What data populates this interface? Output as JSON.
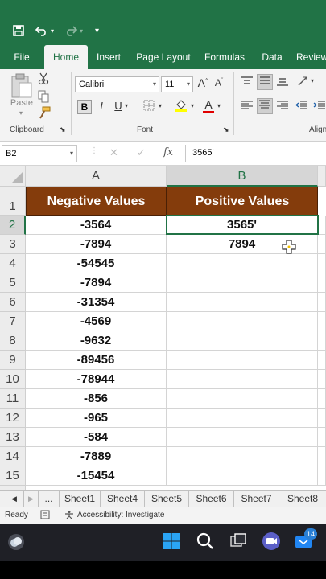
{
  "titlebar": {
    "undo_icon": "undo-icon",
    "redo_icon": "redo-icon"
  },
  "tabs": [
    {
      "label": "File"
    },
    {
      "label": "Home"
    },
    {
      "label": "Insert"
    },
    {
      "label": "Page Layout"
    },
    {
      "label": "Formulas"
    },
    {
      "label": "Data"
    },
    {
      "label": "Review"
    }
  ],
  "ribbon": {
    "paste_label": "Paste",
    "clipboard_label": "Clipboard",
    "font_label": "Font",
    "align_label": "Alignm",
    "font_name": "Calibri",
    "font_size": "11",
    "grow_font": "A",
    "shrink_font": "A",
    "bold": "B",
    "italic": "I",
    "underline": "U",
    "font_color": "A"
  },
  "formula_bar": {
    "name_box": "B2",
    "fx": "fx",
    "content": "3565'",
    "cancel": "✕",
    "confirm": "✓"
  },
  "columns": [
    {
      "label": "A"
    },
    {
      "label": "B"
    }
  ],
  "rows": [
    "1",
    "2",
    "3",
    "4",
    "5",
    "6",
    "7",
    "8",
    "9",
    "10",
    "11",
    "12",
    "13",
    "14",
    "15"
  ],
  "table": {
    "headers": [
      "Negative Values",
      "Positive Values"
    ],
    "col_a": [
      "-3564",
      "-7894",
      "-54545",
      "-7894",
      "-31354",
      "-4569",
      "-9632",
      "-89456",
      "-78944",
      "-856",
      "-965",
      "-584",
      "-7889",
      "-15454"
    ],
    "col_b": [
      "3565'",
      "7894",
      "",
      "",
      "",
      "",
      "",
      "",
      "",
      "",
      "",
      "",
      "",
      ""
    ]
  },
  "sheet_tabs": {
    "ellipsis": "...",
    "sheets": [
      "Sheet1",
      "Sheet4",
      "Sheet5",
      "Sheet6",
      "Sheet7",
      "Sheet8"
    ]
  },
  "status": {
    "ready": "Ready",
    "accessibility": "Accessibility: Investigate"
  },
  "taskbar": {
    "badge_count": "14"
  },
  "colors": {
    "excel_green": "#217346",
    "header_brown": "#843c0c"
  }
}
